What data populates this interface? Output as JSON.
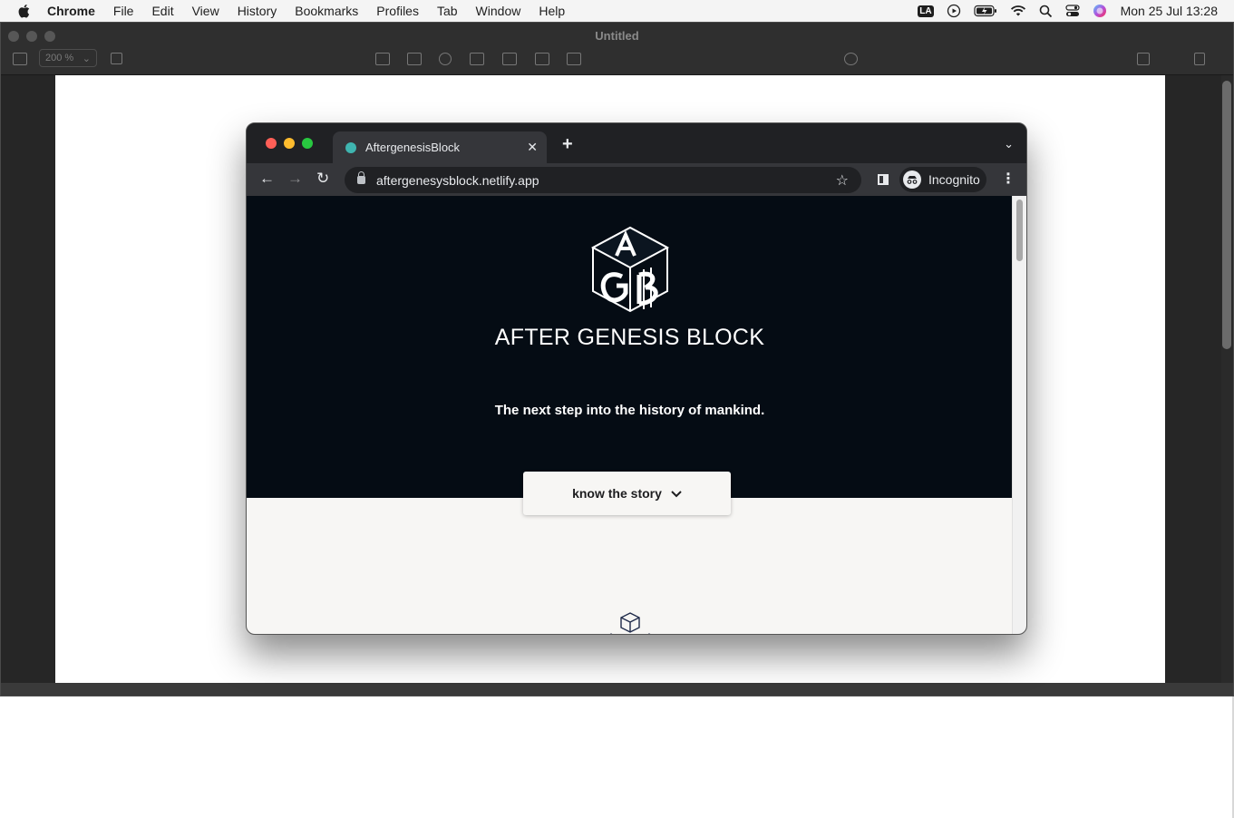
{
  "menubar": {
    "app_name": "Chrome",
    "items": [
      "File",
      "Edit",
      "View",
      "History",
      "Bookmarks",
      "Profiles",
      "Tab",
      "Window",
      "Help"
    ],
    "status": {
      "input_badge": "LA",
      "datetime": "Mon 25 Jul  13:28"
    }
  },
  "keynote": {
    "title": "Untitled",
    "zoom": "200 %"
  },
  "browser": {
    "tab_title": "AftergenesisBlock",
    "url": "aftergenesysblock.netlify.app",
    "profile_label": "Incognito"
  },
  "page": {
    "hero_title": "AFTER GENESIS BLOCK",
    "hero_subtitle": "The next step into the history of mankind.",
    "cta_label": "know the story"
  },
  "colors": {
    "hero_bg": "#050c14",
    "content_bg": "#f7f6f4",
    "traffic_red": "#ff5f57",
    "traffic_yellow": "#febc2e",
    "traffic_green": "#28c840",
    "favicon": "#3fb5b0"
  }
}
